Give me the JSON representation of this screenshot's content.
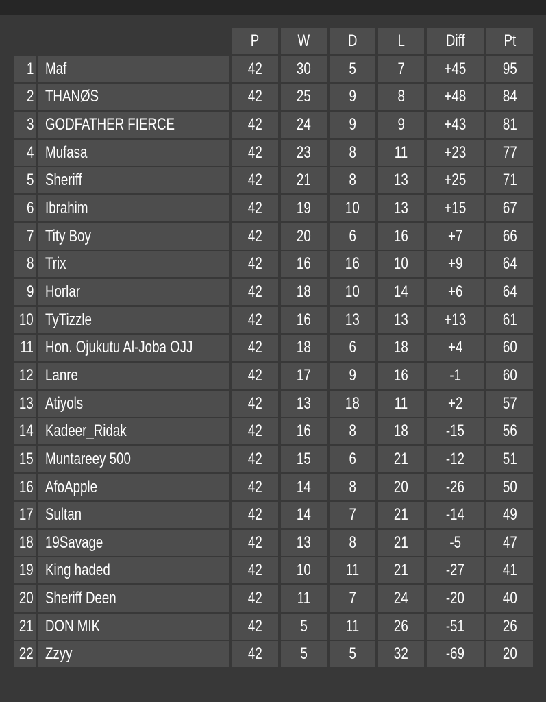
{
  "columns": [
    "P",
    "W",
    "D",
    "L",
    "Diff",
    "Pt"
  ],
  "rows": [
    {
      "rank": "1",
      "name": "Maf",
      "p": "42",
      "w": "30",
      "d": "5",
      "l": "7",
      "diff": "+45",
      "pt": "95"
    },
    {
      "rank": "2",
      "name": "THANØS",
      "p": "42",
      "w": "25",
      "d": "9",
      "l": "8",
      "diff": "+48",
      "pt": "84"
    },
    {
      "rank": "3",
      "name": "GODFATHER FIERCE",
      "p": "42",
      "w": "24",
      "d": "9",
      "l": "9",
      "diff": "+43",
      "pt": "81"
    },
    {
      "rank": "4",
      "name": "Mufasa",
      "p": "42",
      "w": "23",
      "d": "8",
      "l": "11",
      "diff": "+23",
      "pt": "77"
    },
    {
      "rank": "5",
      "name": "Sheriff",
      "p": "42",
      "w": "21",
      "d": "8",
      "l": "13",
      "diff": "+25",
      "pt": "71"
    },
    {
      "rank": "6",
      "name": "Ibrahim",
      "p": "42",
      "w": "19",
      "d": "10",
      "l": "13",
      "diff": "+15",
      "pt": "67"
    },
    {
      "rank": "7",
      "name": "Tity Boy",
      "p": "42",
      "w": "20",
      "d": "6",
      "l": "16",
      "diff": "+7",
      "pt": "66"
    },
    {
      "rank": "8",
      "name": "Trix",
      "p": "42",
      "w": "16",
      "d": "16",
      "l": "10",
      "diff": "+9",
      "pt": "64"
    },
    {
      "rank": "9",
      "name": "Horlar",
      "p": "42",
      "w": "18",
      "d": "10",
      "l": "14",
      "diff": "+6",
      "pt": "64"
    },
    {
      "rank": "10",
      "name": "TyTizzle",
      "p": "42",
      "w": "16",
      "d": "13",
      "l": "13",
      "diff": "+13",
      "pt": "61"
    },
    {
      "rank": "11",
      "name": "Hon. Ojukutu Al-Joba OJJ",
      "p": "42",
      "w": "18",
      "d": "6",
      "l": "18",
      "diff": "+4",
      "pt": "60"
    },
    {
      "rank": "12",
      "name": "Lanre",
      "p": "42",
      "w": "17",
      "d": "9",
      "l": "16",
      "diff": "-1",
      "pt": "60"
    },
    {
      "rank": "13",
      "name": "Atiyols",
      "p": "42",
      "w": "13",
      "d": "18",
      "l": "11",
      "diff": "+2",
      "pt": "57"
    },
    {
      "rank": "14",
      "name": "Kadeer_Ridak",
      "p": "42",
      "w": "16",
      "d": "8",
      "l": "18",
      "diff": "-15",
      "pt": "56"
    },
    {
      "rank": "15",
      "name": "Muntareey 500",
      "p": "42",
      "w": "15",
      "d": "6",
      "l": "21",
      "diff": "-12",
      "pt": "51"
    },
    {
      "rank": "16",
      "name": "AfoApple",
      "p": "42",
      "w": "14",
      "d": "8",
      "l": "20",
      "diff": "-26",
      "pt": "50"
    },
    {
      "rank": "17",
      "name": "Sultan",
      "p": "42",
      "w": "14",
      "d": "7",
      "l": "21",
      "diff": "-14",
      "pt": "49"
    },
    {
      "rank": "18",
      "name": "19Savage",
      "p": "42",
      "w": "13",
      "d": "8",
      "l": "21",
      "diff": "-5",
      "pt": "47"
    },
    {
      "rank": "19",
      "name": "King haded",
      "p": "42",
      "w": "10",
      "d": "11",
      "l": "21",
      "diff": "-27",
      "pt": "41"
    },
    {
      "rank": "20",
      "name": "Sheriff Deen",
      "p": "42",
      "w": "11",
      "d": "7",
      "l": "24",
      "diff": "-20",
      "pt": "40"
    },
    {
      "rank": "21",
      "name": "DON MIK",
      "p": "42",
      "w": "5",
      "d": "11",
      "l": "26",
      "diff": "-51",
      "pt": "26"
    },
    {
      "rank": "22",
      "name": "Zzyy",
      "p": "42",
      "w": "5",
      "d": "5",
      "l": "32",
      "diff": "-69",
      "pt": "20"
    }
  ]
}
